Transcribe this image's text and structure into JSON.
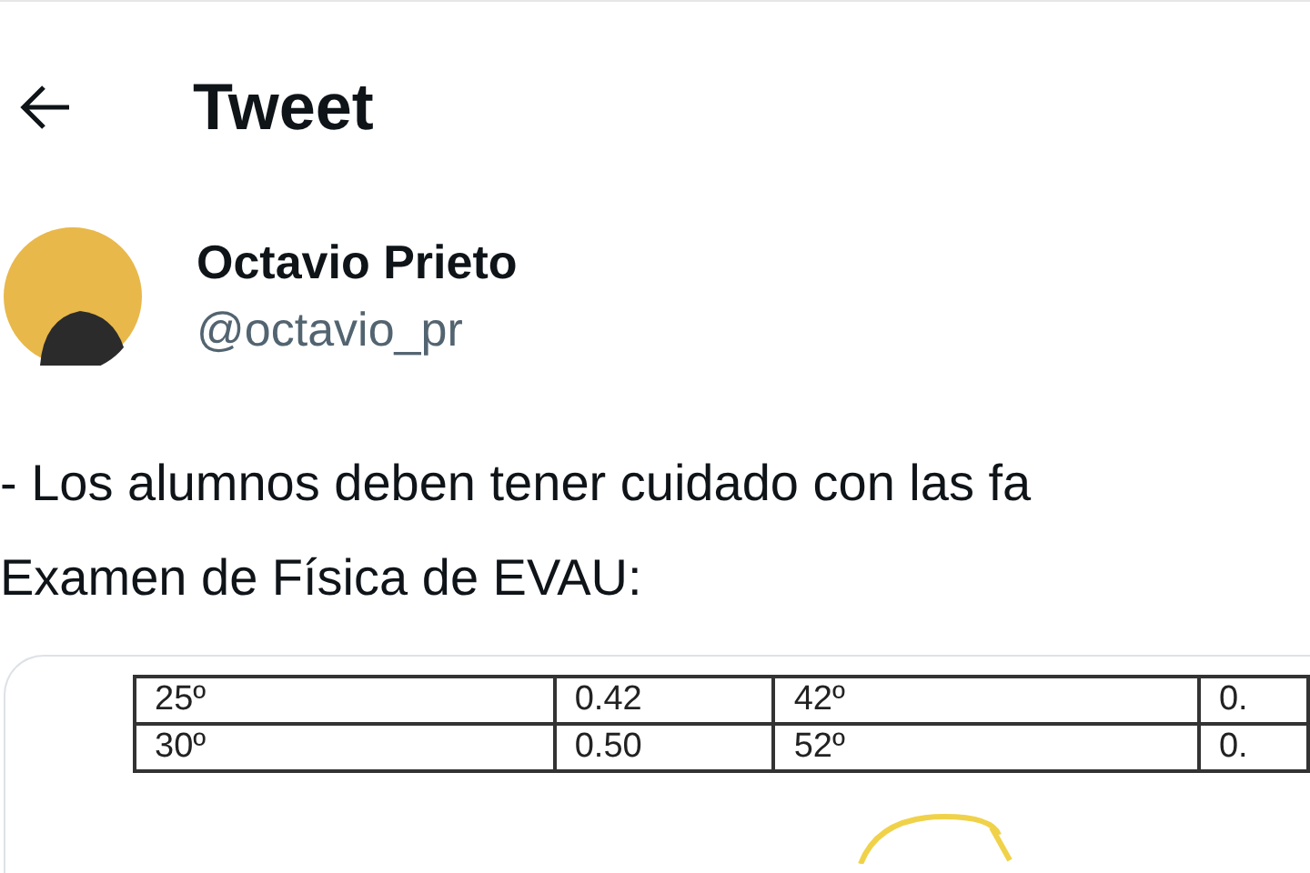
{
  "header": {
    "title": "Tweet"
  },
  "author": {
    "name": "Octavio Prieto",
    "handle": "@octavio_pr"
  },
  "tweet_text": [
    "- Los alumnos deben tener cuidado con las fa",
    "Examen de Física de EVAU:"
  ],
  "attachment": {
    "table": {
      "rows": [
        [
          "25º",
          "0.42",
          "42º",
          "0."
        ],
        [
          "30º",
          "0.50",
          "52º",
          "0."
        ]
      ]
    }
  }
}
